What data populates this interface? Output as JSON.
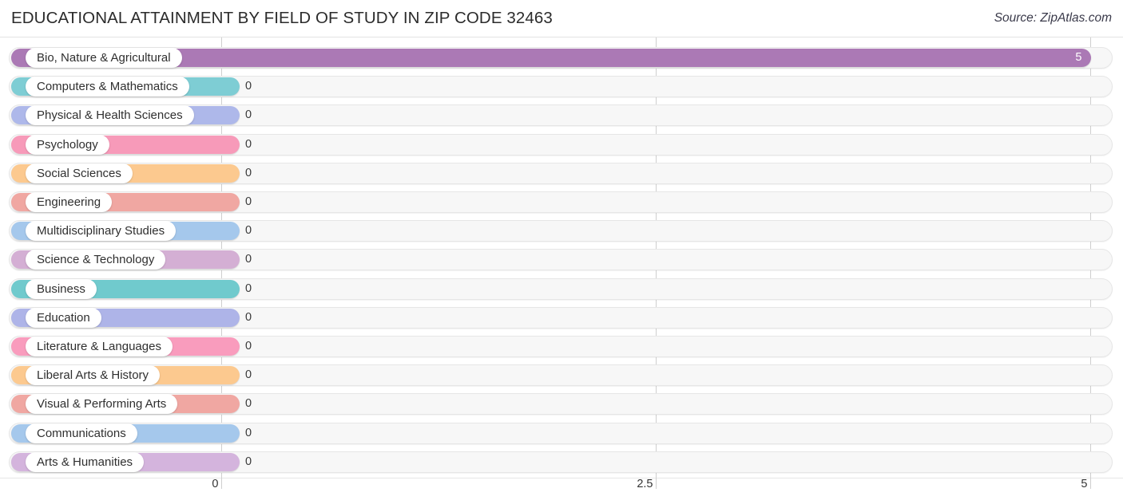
{
  "header": {
    "title": "EDUCATIONAL ATTAINMENT BY FIELD OF STUDY IN ZIP CODE 32463",
    "source": "Source: ZipAtlas.com"
  },
  "chart_data": {
    "type": "bar",
    "orientation": "horizontal",
    "title": "EDUCATIONAL ATTAINMENT BY FIELD OF STUDY IN ZIP CODE 32463",
    "xlabel": "",
    "ylabel": "",
    "xlim": [
      0,
      5
    ],
    "grid": true,
    "legend": "none",
    "axis_ticks": [
      {
        "label": "0",
        "value": 0
      },
      {
        "label": "2.5",
        "value": 2.5
      },
      {
        "label": "5",
        "value": 5
      }
    ],
    "categories": [
      "Bio, Nature & Agricultural",
      "Computers & Mathematics",
      "Physical & Health Sciences",
      "Psychology",
      "Social Sciences",
      "Engineering",
      "Multidisciplinary Studies",
      "Science & Technology",
      "Business",
      "Education",
      "Literature & Languages",
      "Liberal Arts & History",
      "Visual & Performing Arts",
      "Communications",
      "Arts & Humanities"
    ],
    "values": [
      5,
      0,
      0,
      0,
      0,
      0,
      0,
      0,
      0,
      0,
      0,
      0,
      0,
      0,
      0
    ],
    "value_labels": [
      "5",
      "0",
      "0",
      "0",
      "0",
      "0",
      "0",
      "0",
      "0",
      "0",
      "0",
      "0",
      "0",
      "0",
      "0"
    ],
    "colors": [
      "#ab79b5",
      "#7ecdd4",
      "#aeb8ea",
      "#f79ab9",
      "#fcc98f",
      "#f0a7a2",
      "#a5c8ec",
      "#d4afd4",
      "#70cacd",
      "#aeb4e8",
      "#f99cbd",
      "#fcc98f",
      "#f0a7a2",
      "#a5c8ec",
      "#d4b4dd"
    ]
  }
}
